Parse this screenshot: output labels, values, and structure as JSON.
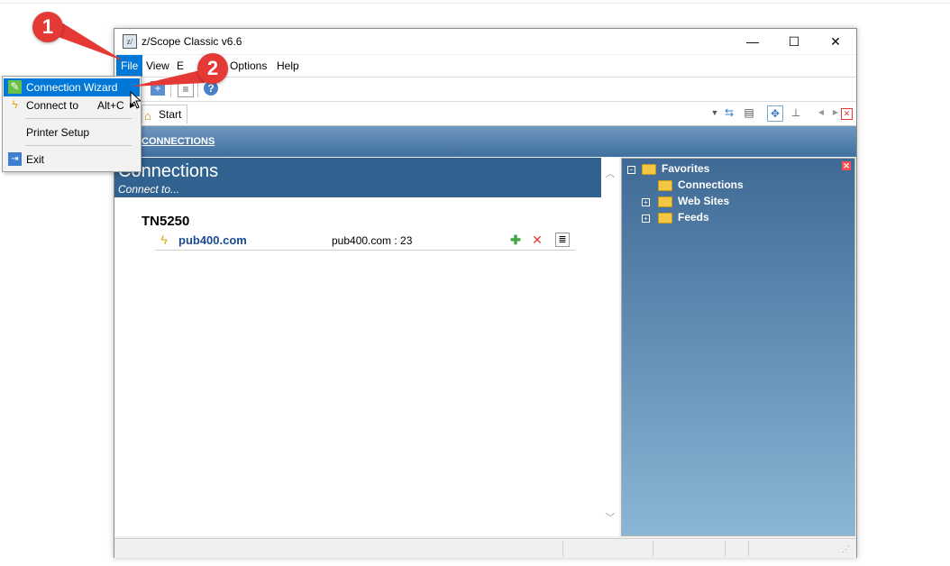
{
  "window": {
    "title": "z/Scope Classic v6.6",
    "app_icon_text": "z/",
    "minimize_glyph": "—",
    "maximize_glyph": "☐",
    "close_glyph": "✕"
  },
  "menu": {
    "file": "File",
    "view": "View",
    "partial": "E",
    "options": "Options",
    "help": "Help"
  },
  "file_menu": {
    "items": [
      {
        "label": "Connection Wizard",
        "icon": "wizard-icon",
        "shortcut": ""
      },
      {
        "label": "Connect to",
        "icon": "lightning-icon",
        "shortcut": "Alt+C"
      },
      {
        "label": "Printer Setup",
        "icon": "",
        "shortcut": ""
      },
      {
        "label": "Exit",
        "icon": "exit-icon",
        "shortcut": ""
      }
    ]
  },
  "tabs": {
    "start": "Start"
  },
  "header": {
    "link": "CONNECTIONS"
  },
  "connections": {
    "title": "Connections",
    "subtitle": "Connect to...",
    "group": "TN5250",
    "rows": [
      {
        "name": "pub400.com",
        "address": "pub400.com : 23"
      }
    ]
  },
  "favorites": {
    "root": "Favorites",
    "items": [
      "Connections",
      "Web Sites",
      "Feeds"
    ]
  },
  "callouts": {
    "one": "1",
    "two": "2"
  },
  "colors": {
    "accent": "#0078d7",
    "header_blue": "#32628f",
    "callout_red": "#e53935"
  }
}
